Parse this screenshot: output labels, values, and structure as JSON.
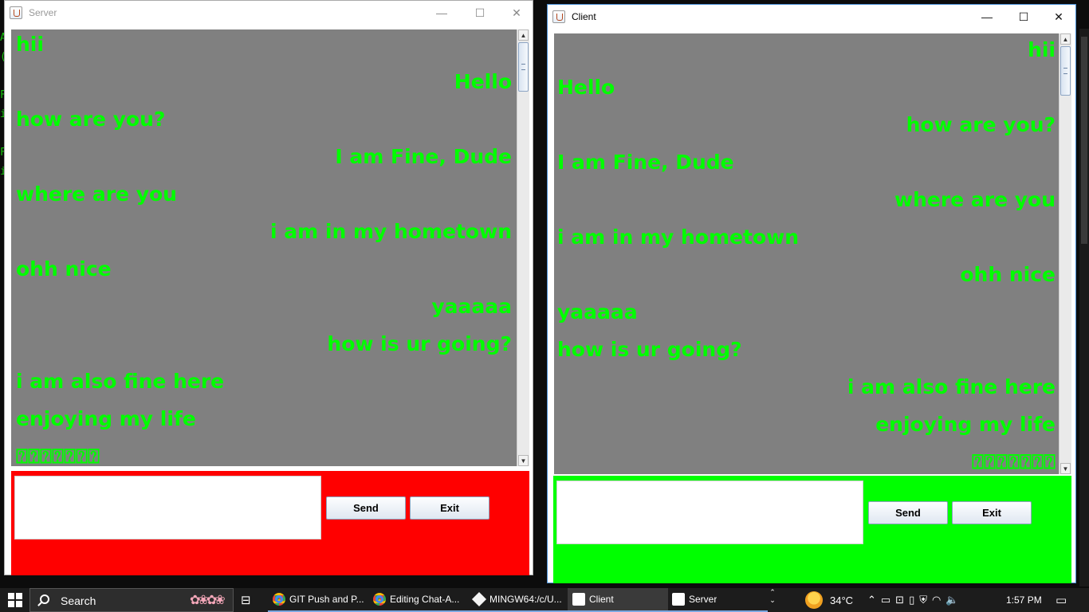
{
  "background_terminal": {
    "visible_chars": [
      "A",
      "(",
      "",
      "F",
      "i",
      "",
      "F",
      "i"
    ]
  },
  "server": {
    "title": "Server",
    "window_controls": {
      "minimize": "—",
      "maximize": "☐",
      "close": "✕"
    },
    "messages": [
      {
        "text": "hii",
        "align": "left"
      },
      {
        "text": "Hello",
        "align": "right"
      },
      {
        "text": " how are you?",
        "align": "left"
      },
      {
        "text": "I am Fine, Dude",
        "align": "right"
      },
      {
        "text": " where are you",
        "align": "left"
      },
      {
        "text": "i am in my hometown",
        "align": "right"
      },
      {
        "text": " ohh nice",
        "align": "left"
      },
      {
        "text": "yaaaaa",
        "align": "right"
      },
      {
        "text": "how is ur going?",
        "align": "right"
      },
      {
        "text": " i am also fine here",
        "align": "left"
      },
      {
        "text": "enjoying my life",
        "align": "left"
      },
      {
        "text": "⍰⍰⍰⍰⍰⍰⍰",
        "align": "left"
      }
    ],
    "input_value": "",
    "send_label": "Send",
    "exit_label": "Exit",
    "panel_color": "#ff0000"
  },
  "client": {
    "title": "Client",
    "window_controls": {
      "minimize": "—",
      "maximize": "☐",
      "close": "✕"
    },
    "messages": [
      {
        "text": "hii",
        "align": "right"
      },
      {
        "text": " Hello",
        "align": "left"
      },
      {
        "text": "how are you?",
        "align": "right"
      },
      {
        "text": " I am Fine, Dude",
        "align": "left"
      },
      {
        "text": "where are you",
        "align": "right"
      },
      {
        "text": " i am in my hometown",
        "align": "left"
      },
      {
        "text": "ohh nice",
        "align": "right"
      },
      {
        "text": " yaaaaa",
        "align": "left"
      },
      {
        "text": "how is ur going?",
        "align": "left"
      },
      {
        "text": "i am also fine here ",
        "align": "right"
      },
      {
        "text": "enjoying my life",
        "align": "right"
      },
      {
        "text": "⍰⍰⍰⍰⍰⍰⍰",
        "align": "right"
      }
    ],
    "input_value": "",
    "send_label": "Send",
    "exit_label": "Exit",
    "panel_color": "#00ff00"
  },
  "chat_text_color": "#00ff00",
  "chat_bg_color": "#808080",
  "taskbar": {
    "search_placeholder": "Search",
    "apps": [
      {
        "label": "GIT Push and P...",
        "icon": "chrome-icon",
        "state": "open"
      },
      {
        "label": "Editing Chat-A...",
        "icon": "chrome-icon",
        "state": "open"
      },
      {
        "label": "MINGW64:/c/U...",
        "icon": "git-bash-icon",
        "state": "open"
      },
      {
        "label": "Client",
        "icon": "java-icon",
        "state": "active"
      },
      {
        "label": "Server",
        "icon": "java-icon",
        "state": "open"
      }
    ],
    "temperature": "34°C",
    "tray_icons": [
      "chevron-up-icon",
      "battery-icon",
      "camera-icon",
      "usb-icon",
      "security-icon",
      "wifi-icon",
      "volume-icon"
    ],
    "time": "1:57 PM"
  }
}
